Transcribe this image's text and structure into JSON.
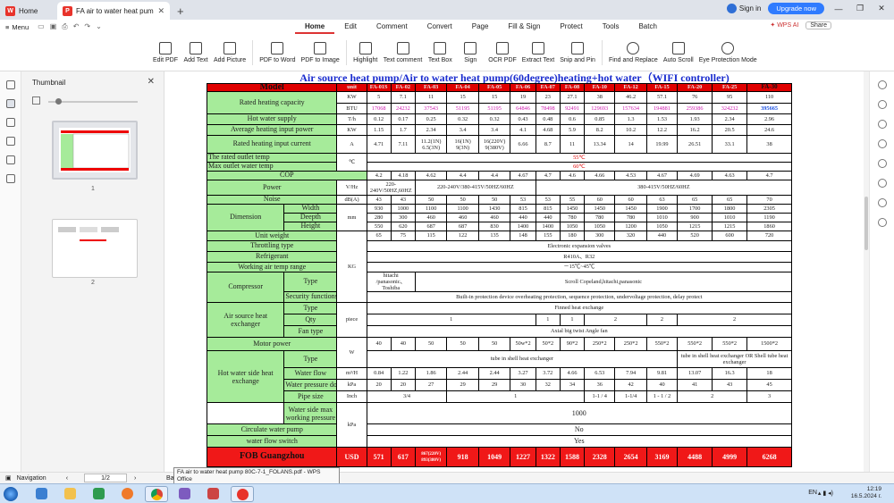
{
  "browser": {
    "home_tab": "Home",
    "doc_tab": "FA air to water heat pump 80C-7-1_FOLANS...",
    "new_tab": "+",
    "sign_in": "Sign in",
    "upgrade": "Upgrade now",
    "window_controls": [
      "—",
      "❐",
      "✕"
    ]
  },
  "menubar": {
    "menu": "Menu",
    "tabs": [
      "Home",
      "Edit",
      "Comment",
      "Convert",
      "Page",
      "Fill & Sign",
      "Protect",
      "Tools",
      "Batch"
    ],
    "active_tab": "Home",
    "wps_ai": "WPS AI",
    "share": "Share"
  },
  "ribbon": {
    "buttons": [
      "Edit PDF",
      "Add Text",
      "Add Picture",
      "PDF to Word",
      "PDF to Image",
      "Highlight",
      "Text comment",
      "Text Box",
      "Sign",
      "OCR PDF",
      "Extract Text",
      "Snip and Pin",
      "Find and Replace",
      "Auto Scroll",
      "Eye Protection Mode"
    ]
  },
  "thumbnail_panel": {
    "title": "Thumbnail",
    "pages": [
      "1",
      "2"
    ]
  },
  "document": {
    "title": "Air source heat pump/Air to water heat pump(60degree)heating+hot water（WIFI controller)",
    "header": {
      "model": "Model",
      "unit": "unit",
      "models": [
        "FA-01S",
        "FA-02",
        "FA-03",
        "FA-04",
        "FA-05",
        "FA-06",
        "FA-07",
        "FA-08",
        "FA-10",
        "FA-12",
        "FA-15",
        "FA-20",
        "FA-25",
        "FA-30"
      ]
    },
    "rows": {
      "rated_heating_capacity": "Rated heating capacity",
      "kw": "KW",
      "heat_kw": [
        "5",
        "7.1",
        "11",
        "15",
        "15",
        "19",
        "23",
        "27.1",
        "38",
        "46.2",
        "57.1",
        "76",
        "95",
        "110"
      ],
      "btu": "BTU",
      "heat_btu": [
        "17068",
        "24232",
        "37543",
        "51195",
        "51195",
        "64846",
        "78498",
        "92491",
        "129693",
        "157634",
        "194881",
        "259386",
        "324232",
        "395665"
      ],
      "hot_water_supply": "Hot water supply",
      "th": "T/h",
      "hws": [
        "0.12",
        "0.17",
        "0.25",
        "0.32",
        "0.32",
        "0.43",
        "0.48",
        "0.6",
        "0.85",
        "1.3",
        "1.53",
        "1.93",
        "2.34",
        "2.96"
      ],
      "avg_power": "Average heating input power",
      "avg_kw": "KW",
      "avg": [
        "1.15",
        "1.7",
        "2.34",
        "3.4",
        "3.4",
        "4.1",
        "4.68",
        "5.9",
        "8.2",
        "10.2",
        "12.2",
        "16.2",
        "20.5",
        "24.6"
      ],
      "rated_current": "Rated heating input current",
      "amp": "A",
      "cur_a": [
        "4.71",
        "7.11"
      ],
      "cur_03": [
        "11.2(1N)",
        "6.5(3N)"
      ],
      "cur_04": [
        "16(1N)",
        "9(3N)"
      ],
      "cur_05": [
        "16(220V)",
        "9(380V)"
      ],
      "cur_b": [
        "6.66",
        "8.7",
        "11",
        "13.34",
        "14",
        "19.99",
        "26.51",
        "33.1",
        "38"
      ],
      "outlet_temp": "The rated outlet temp",
      "max_outlet": "Max outlet water temp",
      "celsius": "℃",
      "outlet_val": "55℃",
      "max_outlet_val": "60℃",
      "cop": "COP",
      "cop_vals": [
        "4.2",
        "4.18",
        "4.62",
        "4.4",
        "4.4",
        "4.67",
        "4.7",
        "4.6",
        "4.66",
        "4.53",
        "4.67",
        "4.69",
        "4.63",
        "4.7"
      ],
      "power": "Power",
      "vhz": "V/Hz",
      "power_1": "220-240V/50HZ,60HZ",
      "power_2": "220-240V/380-415V/50HZ/60HZ",
      "power_3": "380-415V/50HZ/60HZ",
      "noise": "Noise",
      "dba": "dB(A)",
      "noise_vals": [
        "43",
        "43",
        "50",
        "50",
        "50",
        "53",
        "53",
        "55",
        "60",
        "60",
        "63",
        "65",
        "65",
        "70"
      ],
      "dimension": "Dimension",
      "mm": "mm",
      "width": "Width",
      "width_vals": [
        "930",
        "1000",
        "1100",
        "1100",
        "1430",
        "815",
        "815",
        "1450",
        "1450",
        "1450",
        "1900",
        "1700",
        "1800",
        "2305"
      ],
      "depth": "Deepth",
      "depth_vals": [
        "280",
        "300",
        "460",
        "460",
        "460",
        "440",
        "440",
        "780",
        "780",
        "780",
        "1010",
        "900",
        "1010",
        "1190"
      ],
      "height": "Height",
      "height_vals": [
        "550",
        "620",
        "687",
        "687",
        "830",
        "1400",
        "1400",
        "1050",
        "1050",
        "1200",
        "1050",
        "1215",
        "1215",
        "1860"
      ],
      "unit_weight": "Unit weight",
      "kg": "KG",
      "weight_vals": [
        "65",
        "75",
        "115",
        "122",
        "135",
        "148",
        "155",
        "180",
        "300",
        "320",
        "440",
        "520",
        "600",
        "720"
      ],
      "throttling": "Throttling type",
      "throttling_val": "Electronic expansion valves",
      "refrigerant": "Refrigerant",
      "refrigerant_val": "R410A、R32",
      "working_temp": "Working air temp range",
      "working_temp_val": "－15℃~45℃",
      "compressor": "Compressor",
      "type": "Type",
      "comp_type_a": "hitachi /panasonic、Toshiba",
      "comp_type_b": "Scroll Copeland,hitachi,panasonic",
      "security": "Security functions",
      "security_val": "Built-in protection device overheating protection, sequence protection, undervoltage protection, delay protect",
      "air_hx": "Air source heat exchanger",
      "piece": "piece",
      "air_type_val": "Finned heat exchange",
      "qty": "Qty",
      "qty_a": "1",
      "qty_b": "1",
      "qty_c": "1",
      "qty_d": "2",
      "qty_e": "2",
      "qty_f": "2",
      "fan_type": "Fan type",
      "fan_type_val": "Axial big twist Angle fan",
      "motor_power": "Motor power",
      "w": "W",
      "motor_vals": [
        "40",
        "40",
        "50",
        "50",
        "50",
        "50w*2",
        "50*2",
        "90*2",
        "250*2",
        "250*2",
        "550*2",
        "550*2",
        "550*2",
        "1500*2"
      ],
      "water_hx": "Hot water side heat exchange",
      "water_type_a": "tube in shell heat exchanger",
      "water_type_b": "tube in shell heat exchanger OR Shell tube heat exchanger",
      "water_flow": "Water flow",
      "m3h": "m³/H",
      "flow_vals": [
        "0.84",
        "1.22",
        "1.86",
        "2.44",
        "2.44",
        "3.27",
        "3.72",
        "4.66",
        "6.53",
        "7.94",
        "9.81",
        "13.07",
        "16.3",
        "18"
      ],
      "water_pressure_drop": "Water pressure down",
      "kpa": "kPa",
      "wpd_vals": [
        "20",
        "20",
        "27",
        "29",
        "29",
        "30",
        "32",
        "34",
        "36",
        "42",
        "40",
        "41",
        "43",
        "45"
      ],
      "pipe_size": "Pipe size",
      "inch": "Inch",
      "pipe_a": "3/4",
      "pipe_b": "1",
      "pipe_c": "1-1 / 4",
      "pipe_d": "1-1/4",
      "pipe_e": "1 - 1 / 2",
      "pipe_f": "2",
      "pipe_g": "3",
      "max_wp": "Water side max working pressure",
      "kpa2": "kPa",
      "max_wp_val": "1000",
      "circulate_pump": "Circulate water pump",
      "circulate_val": "No",
      "flow_switch": "water flow switch",
      "flow_switch_val": "Yes",
      "fob": "FOB Guangzhou",
      "usd": "USD",
      "fob_vals": [
        "571",
        "617",
        "867(220V)",
        "918",
        "1049",
        "1227",
        "1322",
        "1588",
        "2328",
        "2654",
        "3169",
        "4488",
        "4999",
        "6268"
      ],
      "fob_03b": "893(380V)"
    }
  },
  "statusbar": {
    "navigation": "Navigation",
    "page": "1/2",
    "ba": "Ba",
    "tooltip": "FA air to water heat pump 80C-7-1_FOLANS.pdf - WPS Office"
  },
  "taskbar": {
    "lang": "EN",
    "time": "12:19",
    "date": "16.5.2024 г."
  }
}
